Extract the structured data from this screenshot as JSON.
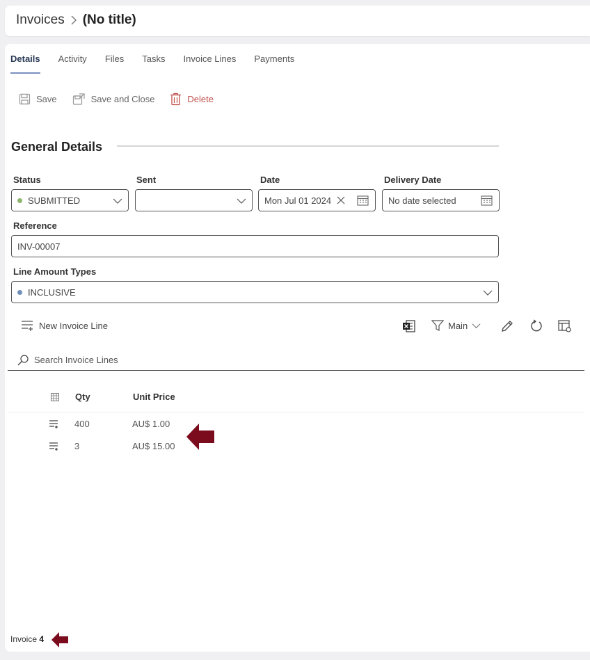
{
  "breadcrumb": {
    "parent": "Invoices",
    "separator": ">",
    "title": "(No title)"
  },
  "tabs": [
    "Details",
    "Activity",
    "Files",
    "Tasks",
    "Invoice Lines",
    "Payments"
  ],
  "toolbar": {
    "save": "Save",
    "save_close": "Save and Close",
    "delete": "Delete"
  },
  "section": {
    "title": "General Details"
  },
  "form": {
    "status": {
      "label": "Status",
      "value": "SUBMITTED",
      "dot_color": "#8db56c"
    },
    "sent": {
      "label": "Sent",
      "value": ""
    },
    "date": {
      "label": "Date",
      "value": "Mon Jul 01 2024"
    },
    "delivery": {
      "label": "Delivery Date",
      "value": "No date selected"
    },
    "reference": {
      "label": "Reference",
      "value": "INV-00007"
    },
    "line_amount": {
      "label": "Line Amount Types",
      "value": "INCLUSIVE",
      "dot_color": "#6f8fb8"
    }
  },
  "grid": {
    "new_line": "New Invoice Line",
    "view": "Main",
    "search_placeholder": "Search Invoice Lines",
    "columns": [
      "Qty",
      "Unit Price"
    ],
    "rows": [
      {
        "qty": "400",
        "unit_price": "AU$ 1.00"
      },
      {
        "qty": "3",
        "unit_price": "AU$ 15.00"
      }
    ]
  },
  "footer": {
    "label": "Invoice",
    "number": "4"
  },
  "colors": {
    "annotation_arrow": "#7a0c1e",
    "delete": "#c0504d",
    "tab_underline": "#7b8fbf"
  }
}
